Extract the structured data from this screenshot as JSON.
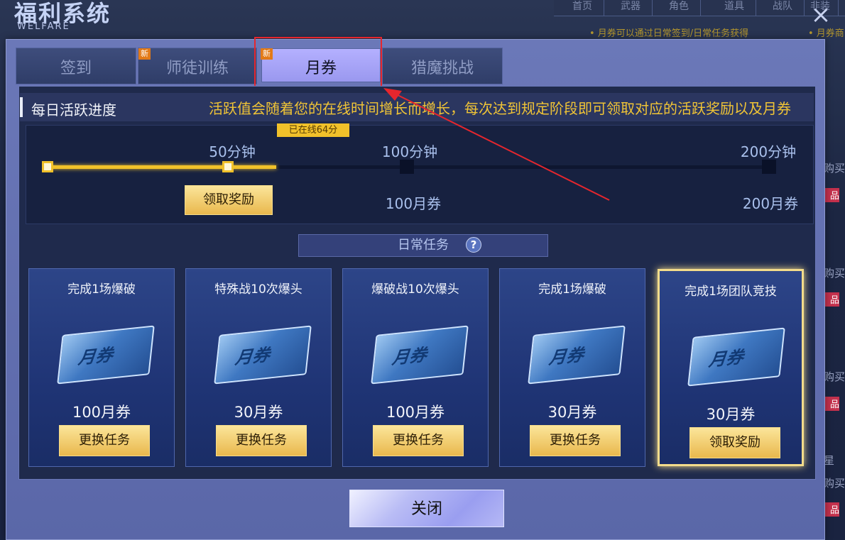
{
  "background": {
    "nav": [
      "首页",
      "武器",
      "角色",
      "道具",
      "战队",
      "非装"
    ],
    "hint": "• 月券可以通过日常签到/日常任务获得",
    "hint2": "• 月券商",
    "side_items": [
      "购买",
      "品",
      "购买",
      "品",
      "购买",
      "品",
      "星",
      "购买",
      "品"
    ]
  },
  "window": {
    "title": "福利系统",
    "subtitle": "WELFARE",
    "close_icon": "×"
  },
  "tabs": [
    {
      "label": "签到",
      "new": false,
      "active": false
    },
    {
      "label": "师徒训练",
      "new": true,
      "active": false
    },
    {
      "label": "月券",
      "new": true,
      "active": true
    },
    {
      "label": "猎魔挑战",
      "new": false,
      "active": false
    }
  ],
  "new_badge": "新",
  "activity": {
    "title": "每日活跃进度",
    "description": "活跃值会随着您的在线时间增长而增长，每次达到规定阶段即可领取对应的活跃奖励以及月券",
    "online_tag": "已在线64分",
    "online_minutes": 64,
    "max_minutes": 200,
    "steps": [
      {
        "label": "50分钟",
        "minutes": 50,
        "reward": "",
        "button": "领取奖励",
        "reached": true
      },
      {
        "label": "100分钟",
        "minutes": 100,
        "reward": "100月券",
        "button": "",
        "reached": false
      },
      {
        "label": "200分钟",
        "minutes": 200,
        "reward": "200月券",
        "button": "",
        "reached": false
      }
    ]
  },
  "daily": {
    "title": "日常任务",
    "help_icon": "?",
    "tasks": [
      {
        "title": "完成1场爆破",
        "amount": "100月券",
        "button": "更换任务",
        "highlight": false
      },
      {
        "title": "特殊战10次爆头",
        "amount": "30月券",
        "button": "更换任务",
        "highlight": false
      },
      {
        "title": "爆破战10次爆头",
        "amount": "100月券",
        "button": "更换任务",
        "highlight": false
      },
      {
        "title": "完成1场爆破",
        "amount": "30月券",
        "button": "更换任务",
        "highlight": false
      },
      {
        "title": "完成1场团队竞技",
        "amount": "30月券",
        "button": "领取奖励",
        "highlight": true
      }
    ],
    "ticket_text": "月券"
  },
  "close_button": "关闭",
  "colors": {
    "accent_gold": "#f1c12a",
    "annotation_red": "#e6262d",
    "active_tab": "#a9a6f6"
  }
}
